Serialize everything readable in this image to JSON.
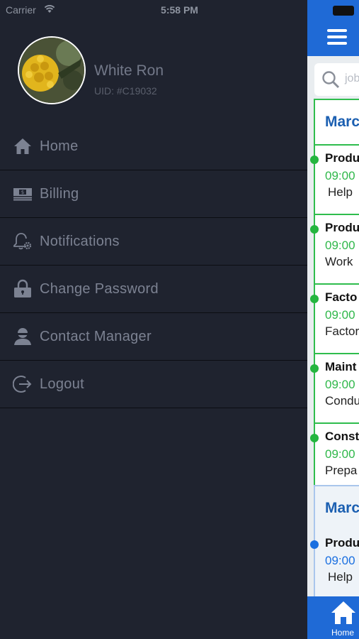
{
  "status_bar": {
    "carrier": "Carrier",
    "time": "5:58 PM"
  },
  "profile": {
    "name": "White Ron",
    "uid": "UID: #C19032"
  },
  "menu": [
    {
      "label": "Home",
      "icon": "home-icon"
    },
    {
      "label": "Billing",
      "icon": "billing-icon"
    },
    {
      "label": "Notifications",
      "icon": "notification-gear-icon"
    },
    {
      "label": "Change Password",
      "icon": "lock-icon"
    },
    {
      "label": "Contact Manager",
      "icon": "manager-icon"
    },
    {
      "label": "Logout",
      "icon": "logout-icon"
    }
  ],
  "main": {
    "search_placeholder": "job",
    "groups": [
      {
        "date": "Marc",
        "jobs": [
          {
            "title": "Produ",
            "time": "09:00",
            "desc": "Help"
          },
          {
            "title": "Produ",
            "time": "09:00",
            "desc": "Work"
          },
          {
            "title": "Facto",
            "time": "09:00",
            "desc": "Factor"
          },
          {
            "title": "Maint",
            "time": "09:00",
            "desc": "Condu"
          },
          {
            "title": "Const",
            "time": "09:00",
            "desc": "Prepa"
          }
        ]
      },
      {
        "date": "Marc",
        "jobs": [
          {
            "title": "Produ",
            "time": "09:00",
            "desc": "Help"
          }
        ]
      }
    ],
    "tab": {
      "label": "Home",
      "icon": "home-icon"
    }
  },
  "colors": {
    "drawer_bg": "#1f232f",
    "header_blue": "#1f6ad6",
    "accent_green": "#2fbd4d",
    "accent_blue": "#1a6fe0"
  }
}
